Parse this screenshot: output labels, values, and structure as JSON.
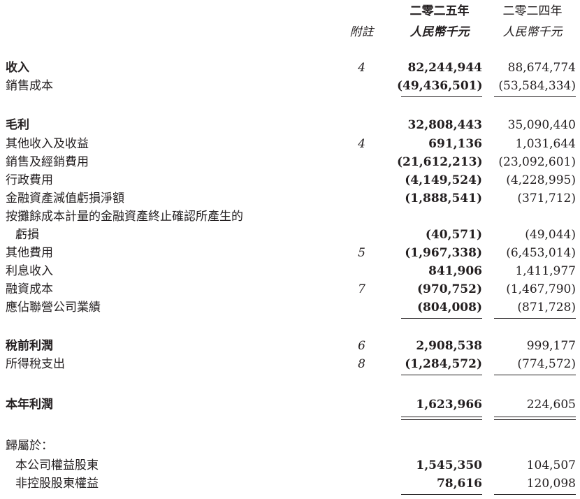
{
  "header": {
    "year_2025": "二零二五年",
    "year_2024": "二零二四年",
    "note_label": "附註",
    "unit_2025": "人民幣千元",
    "unit_2024": "人民幣千元"
  },
  "rows": [
    {
      "label": "收入",
      "note": "4",
      "v2025": "82,244,944",
      "v2024": "88,674,774"
    },
    {
      "label": "銷售成本",
      "note": "",
      "v2025": "(49,436,501)",
      "v2024": "(53,584,334)"
    },
    {
      "label": "毛利",
      "note": "",
      "v2025": "32,808,443",
      "v2024": "35,090,440"
    },
    {
      "label": "其他收入及收益",
      "note": "4",
      "v2025": "691,136",
      "v2024": "1,031,644"
    },
    {
      "label": "銷售及經銷費用",
      "note": "",
      "v2025": "(21,612,213)",
      "v2024": "(23,092,601)"
    },
    {
      "label": "行政費用",
      "note": "",
      "v2025": "(4,149,524)",
      "v2024": "(4,228,995)"
    },
    {
      "label": "金融資產減值虧損淨額",
      "note": "",
      "v2025": "(1,888,541)",
      "v2024": "(371,712)"
    },
    {
      "label": "按攤餘成本計量的金融資產終止確認所產生的",
      "note": "",
      "v2025": "",
      "v2024": ""
    },
    {
      "label": "虧損",
      "note": "",
      "v2025": "(40,571)",
      "v2024": "(49,044)"
    },
    {
      "label": "其他費用",
      "note": "5",
      "v2025": "(1,967,338)",
      "v2024": "(6,453,014)"
    },
    {
      "label": "利息收入",
      "note": "",
      "v2025": "841,906",
      "v2024": "1,411,977"
    },
    {
      "label": "融資成本",
      "note": "7",
      "v2025": "(970,752)",
      "v2024": "(1,467,790)"
    },
    {
      "label": "應佔聯營公司業績",
      "note": "",
      "v2025": "(804,008)",
      "v2024": "(871,728)"
    },
    {
      "label": "稅前利潤",
      "note": "6",
      "v2025": "2,908,538",
      "v2024": "999,177"
    },
    {
      "label": "所得稅支出",
      "note": "8",
      "v2025": "(1,284,572)",
      "v2024": "(774,572)"
    },
    {
      "label": "本年利潤",
      "note": "",
      "v2025": "1,623,966",
      "v2024": "224,605"
    },
    {
      "label": "歸屬於：",
      "note": "",
      "v2025": "",
      "v2024": ""
    },
    {
      "label": "本公司權益股東",
      "note": "",
      "v2025": "1,545,350",
      "v2024": "104,507"
    },
    {
      "label": "非控股股東權益",
      "note": "",
      "v2025": "78,616",
      "v2024": "120,098"
    }
  ]
}
